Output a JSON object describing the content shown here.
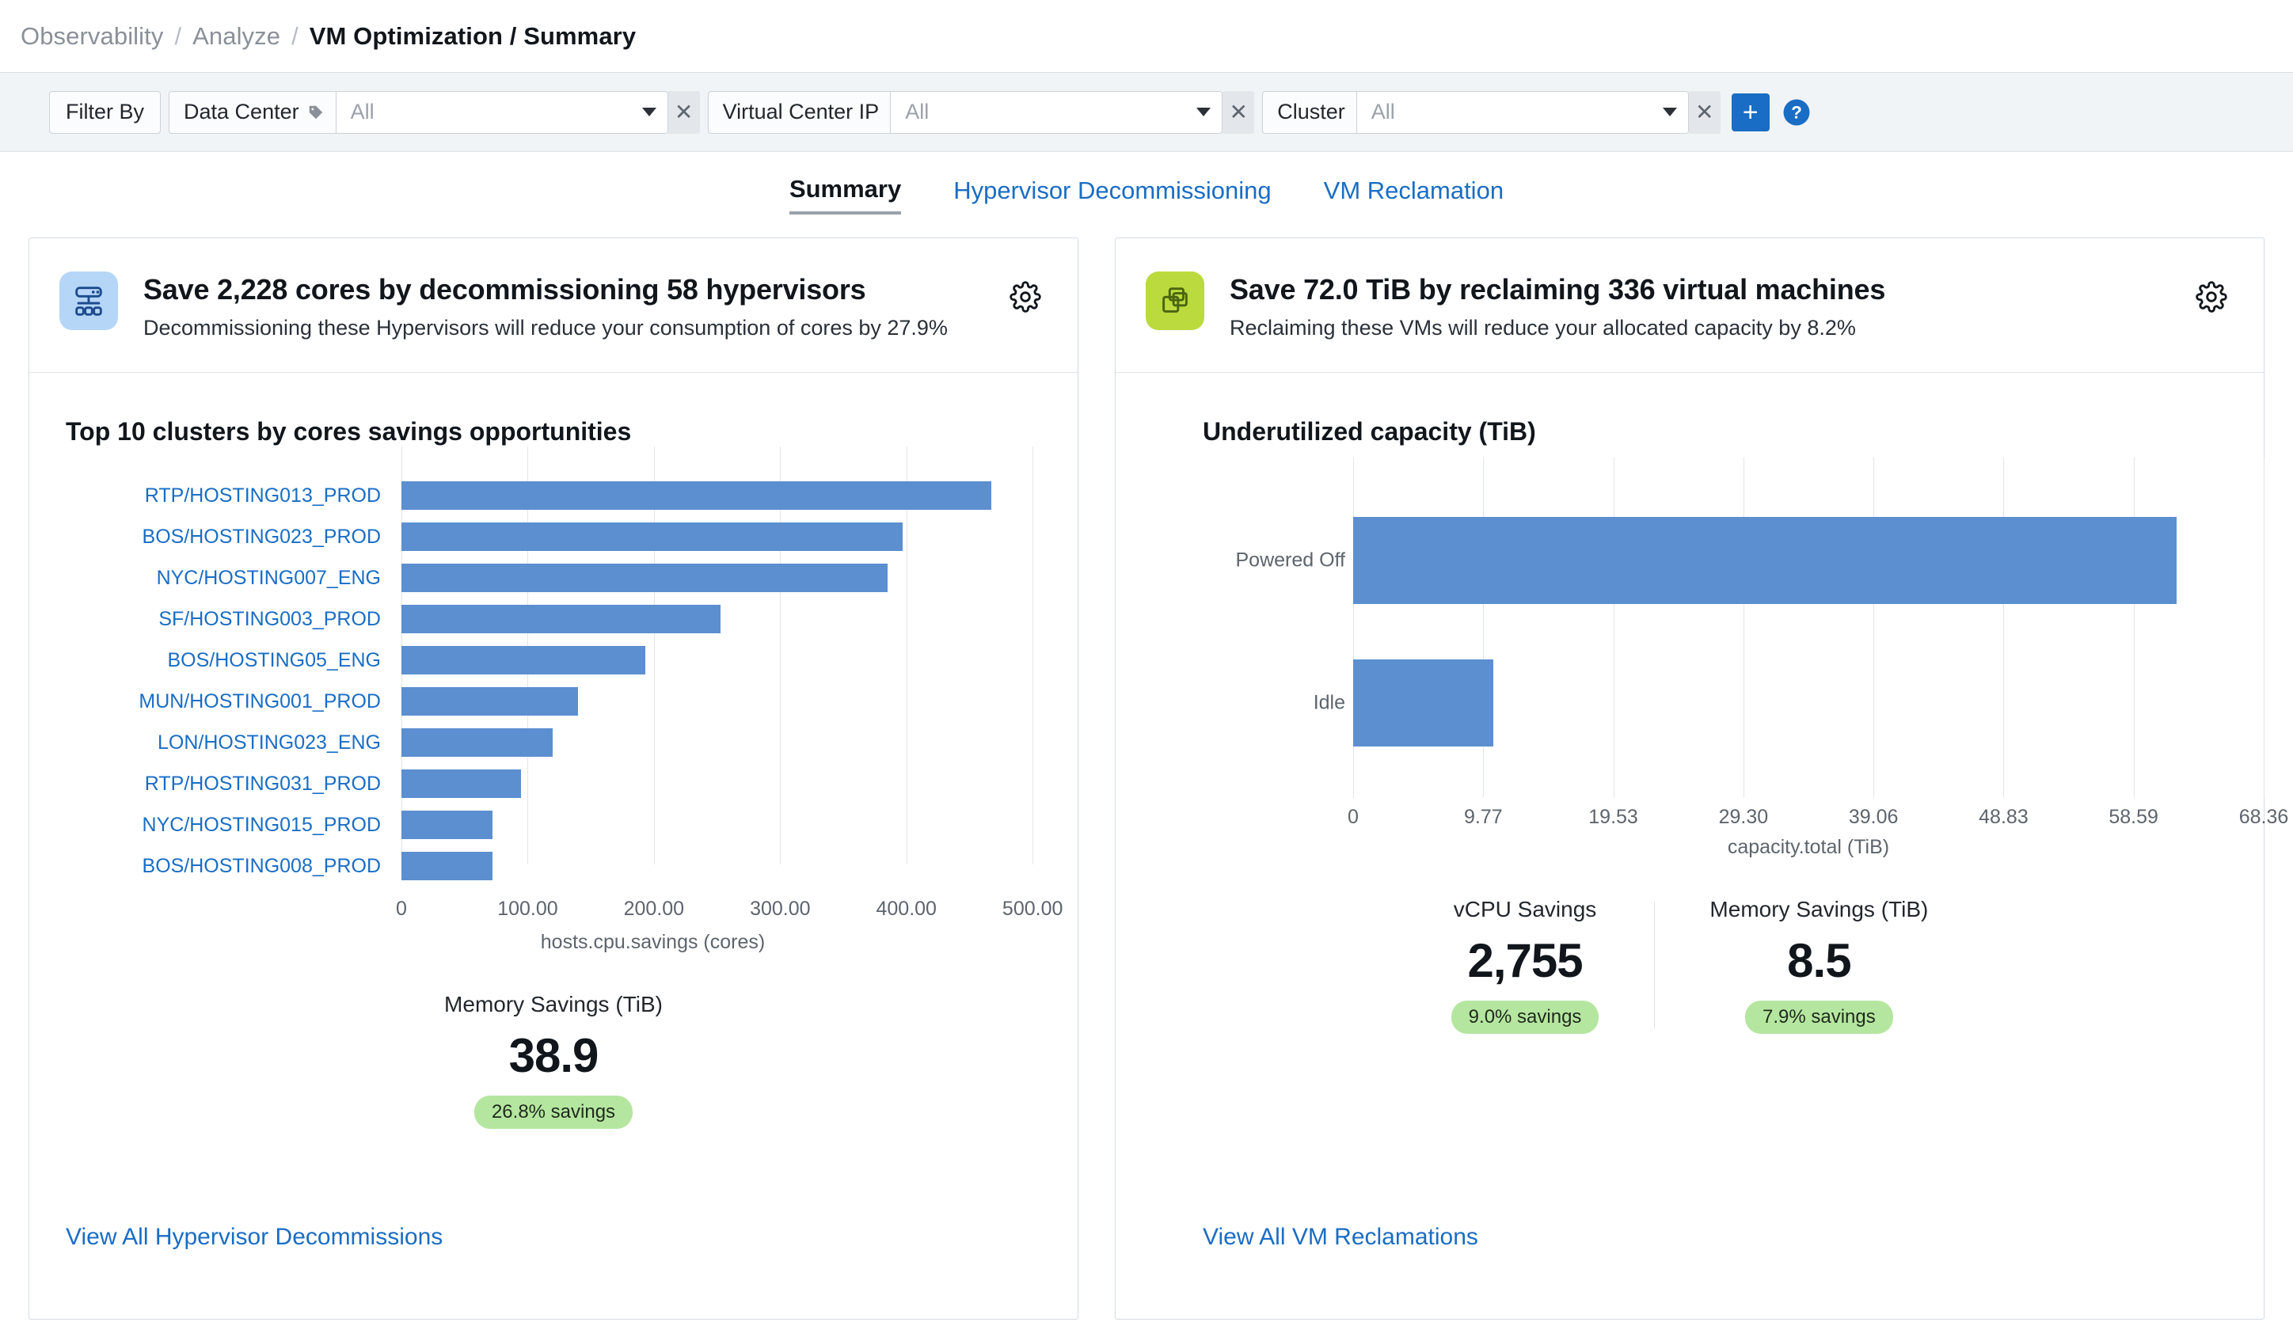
{
  "breadcrumb": {
    "items": [
      "Observability",
      "Analyze"
    ],
    "current": "VM Optimization / Summary",
    "separator": "/"
  },
  "filter_bar": {
    "filter_by_label": "Filter By",
    "filters": [
      {
        "key": "Data Center",
        "value": "All",
        "has_tag_icon": true,
        "clear": "✕"
      },
      {
        "key": "Virtual Center IP",
        "value": "All",
        "has_tag_icon": false,
        "clear": "✕"
      },
      {
        "key": "Cluster",
        "value": "All",
        "has_tag_icon": false,
        "clear": "✕"
      }
    ],
    "add_label": "+",
    "help_label": "?",
    "accent": "#1a6dc4"
  },
  "tabs": [
    {
      "label": "Summary",
      "active": true
    },
    {
      "label": "Hypervisor Decommissioning",
      "active": false
    },
    {
      "label": "VM Reclamation",
      "active": false
    }
  ],
  "left_card": {
    "icon": "server-icon",
    "icon_bg": "#b5d6f7",
    "title": "Save 2,228 cores by decommissioning 58 hypervisors",
    "subtitle": "Decommissioning these Hypervisors will reduce your consumption of cores by 27.9%",
    "settings_icon": "gear-icon",
    "metrics": [
      {
        "label": "Memory Savings (TiB)",
        "value": "38.9",
        "badge": "26.8% savings"
      }
    ],
    "footer_link": "View All Hypervisor Decommissions"
  },
  "right_card": {
    "icon": "virtual-machines-icon",
    "icon_bg": "#bada3e",
    "title": "Save 72.0 TiB by reclaiming 336 virtual machines",
    "subtitle": "Reclaiming these VMs will reduce your allocated capacity by 8.2%",
    "settings_icon": "gear-icon",
    "metrics": [
      {
        "label": "vCPU Savings",
        "value": "2,755",
        "badge": "9.0% savings"
      },
      {
        "label": "Memory Savings (TiB)",
        "value": "8.5",
        "badge": "7.9% savings"
      }
    ],
    "footer_link": "View All VM Reclamations"
  },
  "chart_data": [
    {
      "type": "bar",
      "orientation": "horizontal",
      "title": "Top 10 clusters by cores savings opportunities",
      "xlabel": "hosts.cpu.savings (cores)",
      "ylabel": "",
      "categories": [
        "RTP/HOSTING013_PROD",
        "BOS/HOSTING023_PROD",
        "NYC/HOSTING007_ENG",
        "SF/HOSTING003_PROD",
        "BOS/HOSTING05_ENG",
        "MUN/HOSTING001_PROD",
        "LON/HOSTING023_ENG",
        "RTP/HOSTING031_PROD",
        "NYC/HOSTING015_PROD",
        "BOS/HOSTING008_PROD"
      ],
      "values": [
        467,
        397,
        385,
        253,
        193,
        140,
        120,
        95,
        72,
        72
      ],
      "tick_labels": [
        "0",
        "100.00",
        "200.00",
        "300.00",
        "400.00",
        "500.00"
      ],
      "tick_values": [
        0,
        100,
        200,
        300,
        400,
        500
      ],
      "xlim": [
        0,
        530
      ],
      "grid": true,
      "bar_color": "#5b8fd0",
      "label_color": "#1a6dc4"
    },
    {
      "type": "bar",
      "orientation": "horizontal",
      "title": "Underutilized capacity (TiB)",
      "xlabel": "capacity.total (TiB)",
      "ylabel": "",
      "categories": [
        "Powered Off",
        "Idle"
      ],
      "values": [
        61.8,
        10.5
      ],
      "tick_labels": [
        "0",
        "9.77",
        "19.53",
        "29.30",
        "39.06",
        "48.83",
        "58.59",
        "68.36"
      ],
      "tick_values": [
        0,
        9.77,
        19.53,
        29.3,
        39.06,
        48.83,
        58.59,
        68.36
      ],
      "xlim": [
        0,
        68.36
      ],
      "grid": true,
      "bar_color": "#5b8fd0",
      "label_color": "#5d646d"
    }
  ]
}
